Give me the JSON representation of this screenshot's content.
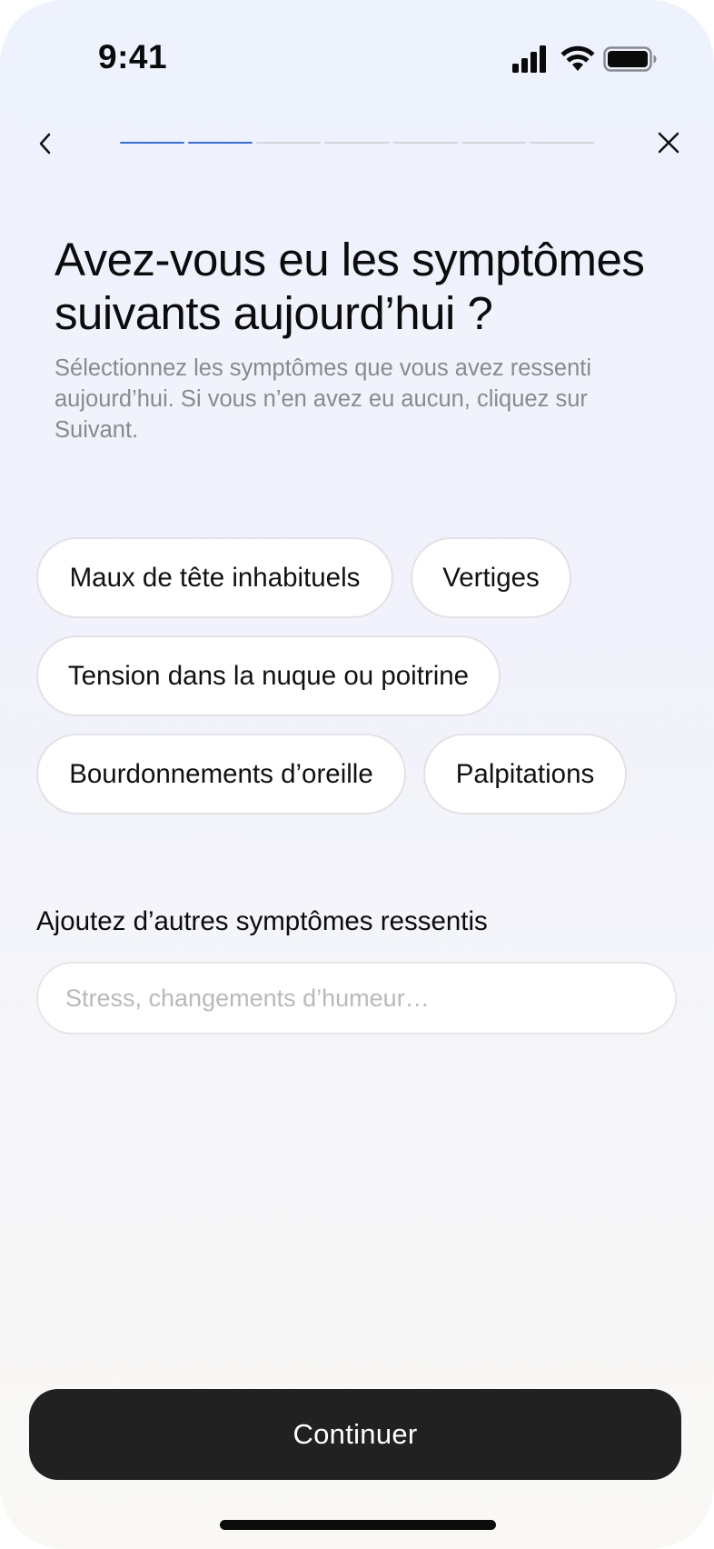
{
  "status_bar": {
    "time": "9:41",
    "icons": [
      "cellular-signal-icon",
      "wifi-icon",
      "battery-icon"
    ]
  },
  "nav": {
    "back_icon": "chevron-left-icon",
    "close_icon": "close-icon",
    "progress": {
      "total_steps": 7,
      "completed_steps": 2,
      "accent_color": "#2e6fe8"
    }
  },
  "question": {
    "title": "Avez-vous eu les symptômes suivants aujourd’hui ?",
    "subtitle": "Sélectionnez les symptômes que vous avez ressenti aujourd’hui. Si vous n’en avez eu aucun, cliquez sur Suivant."
  },
  "symptoms": [
    {
      "label": "Maux de tête inhabituels"
    },
    {
      "label": "Vertiges"
    },
    {
      "label": "Tension dans la nuque ou poitrine"
    },
    {
      "label": "Bourdonnements d’oreille"
    },
    {
      "label": "Palpitations"
    }
  ],
  "other_symptoms": {
    "label": "Ajoutez d’autres symptômes ressentis",
    "placeholder": "Stress, changements d’humeur…",
    "value": ""
  },
  "footer": {
    "continue_label": "Continuer"
  }
}
